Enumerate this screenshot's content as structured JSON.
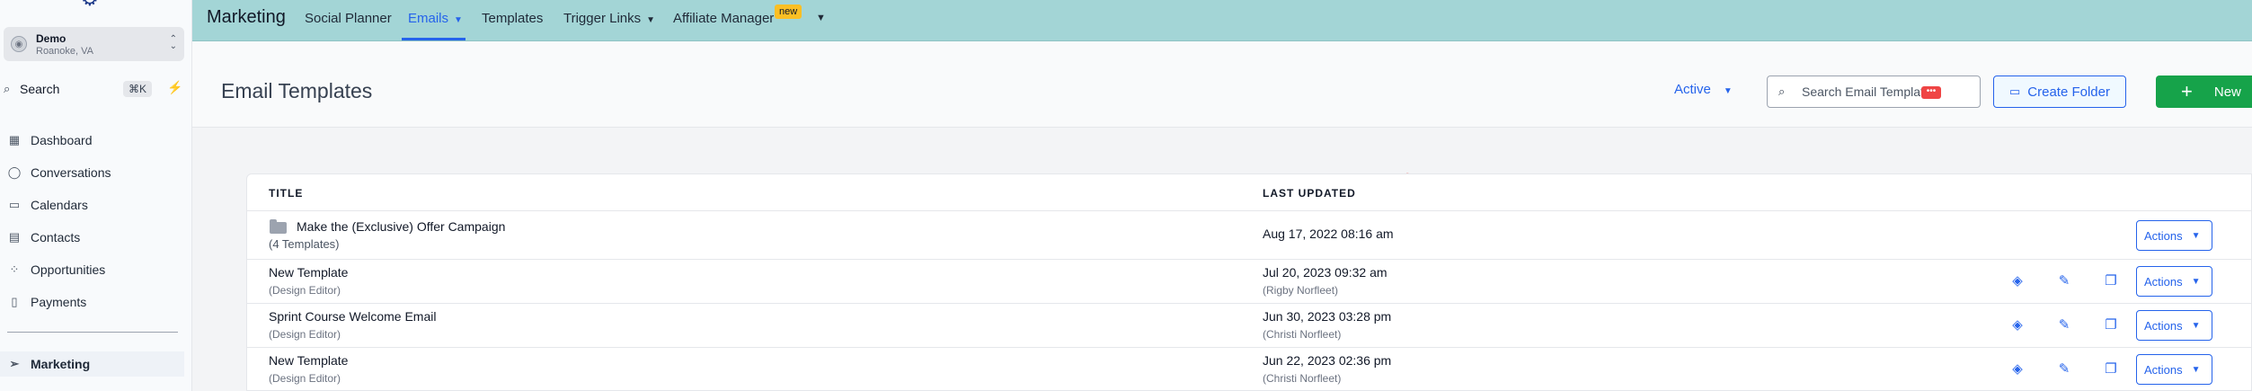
{
  "sidebar": {
    "account": {
      "name": "Demo",
      "location": "Roanoke, VA"
    },
    "search": {
      "label": "Search",
      "shortcut": "⌘K"
    },
    "items": [
      {
        "label": "Dashboard",
        "icon": "grid-icon"
      },
      {
        "label": "Conversations",
        "icon": "chat-icon"
      },
      {
        "label": "Calendars",
        "icon": "calendar-icon"
      },
      {
        "label": "Contacts",
        "icon": "contacts-icon"
      },
      {
        "label": "Opportunities",
        "icon": "opportunities-icon"
      },
      {
        "label": "Payments",
        "icon": "payments-icon"
      },
      {
        "label": "Marketing",
        "icon": "send-icon"
      }
    ]
  },
  "topbar": {
    "title": "Marketing",
    "items": [
      {
        "label": "Social Planner"
      },
      {
        "label": "Emails"
      },
      {
        "label": "Templates"
      },
      {
        "label": "Trigger Links"
      },
      {
        "label": "Affiliate Manager"
      }
    ],
    "new_badge": "new"
  },
  "header": {
    "title": "Email Templates",
    "status_filter": "Active",
    "search_placeholder": "Search Email Templates",
    "create_folder": "Create Folder",
    "new_button": "New"
  },
  "table": {
    "columns": {
      "title": "TITLE",
      "last_updated": "LAST UPDATED"
    },
    "rows": [
      {
        "title": "Make the (Exclusive) Offer Campaign",
        "sub": "(4 Templates)",
        "date": "Aug 17, 2022 08:16 am",
        "by": "",
        "actions": "Actions"
      },
      {
        "title": "New Template",
        "sub": "(Design Editor)",
        "date": "Jul 20, 2023 09:32 am",
        "by": "(Rigby Norfleet)",
        "actions": "Actions"
      },
      {
        "title": "Sprint Course Welcome Email",
        "sub": "(Design Editor)",
        "date": "Jun 30, 2023 03:28 pm",
        "by": "(Christi Norfleet)",
        "actions": "Actions"
      },
      {
        "title": "New Template",
        "sub": "(Design Editor)",
        "date": "Jun 22, 2023 02:36 pm",
        "by": "(Christi Norfleet)",
        "actions": "Actions"
      }
    ]
  },
  "colors": {
    "accent": "#2563eb",
    "new_button": "#16a34a",
    "topbar": "#a3d5d6",
    "annotation_arrow": "#e11d1d"
  }
}
